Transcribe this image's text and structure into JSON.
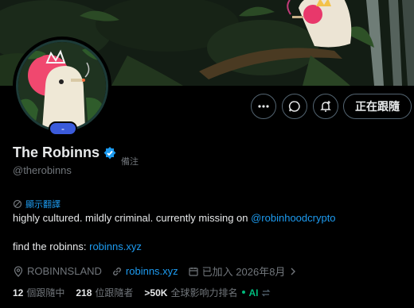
{
  "profile": {
    "display_name": "The Robinns",
    "handle": "@therobinns",
    "note_label": "備注",
    "avatar_badge": "-",
    "translate_label": "顯示翻譯",
    "bio_text": "highly cultured. mildly criminal. currently missing on ",
    "bio_mention": "@robinhoodcrypto",
    "bio2_text": "find the robinns: ",
    "bio2_link": "robinns.xyz",
    "location": "ROBINNSLAND",
    "website": "robinns.xyz",
    "joined": "已加入 2026年8月"
  },
  "actions": {
    "follow_label": "正在跟隨"
  },
  "stats": {
    "following_count": "12",
    "following_label": "個跟隨中",
    "followers_count": "218",
    "followers_label": "位跟隨者",
    "rank_value": ">50K",
    "rank_label": "全球影响力排名",
    "ai_label": "AI"
  },
  "colors": {
    "accent": "#1d9bf0",
    "verified": "#1d9bf0",
    "ai": "#00ba7c",
    "badge": "#3b5bdb"
  }
}
